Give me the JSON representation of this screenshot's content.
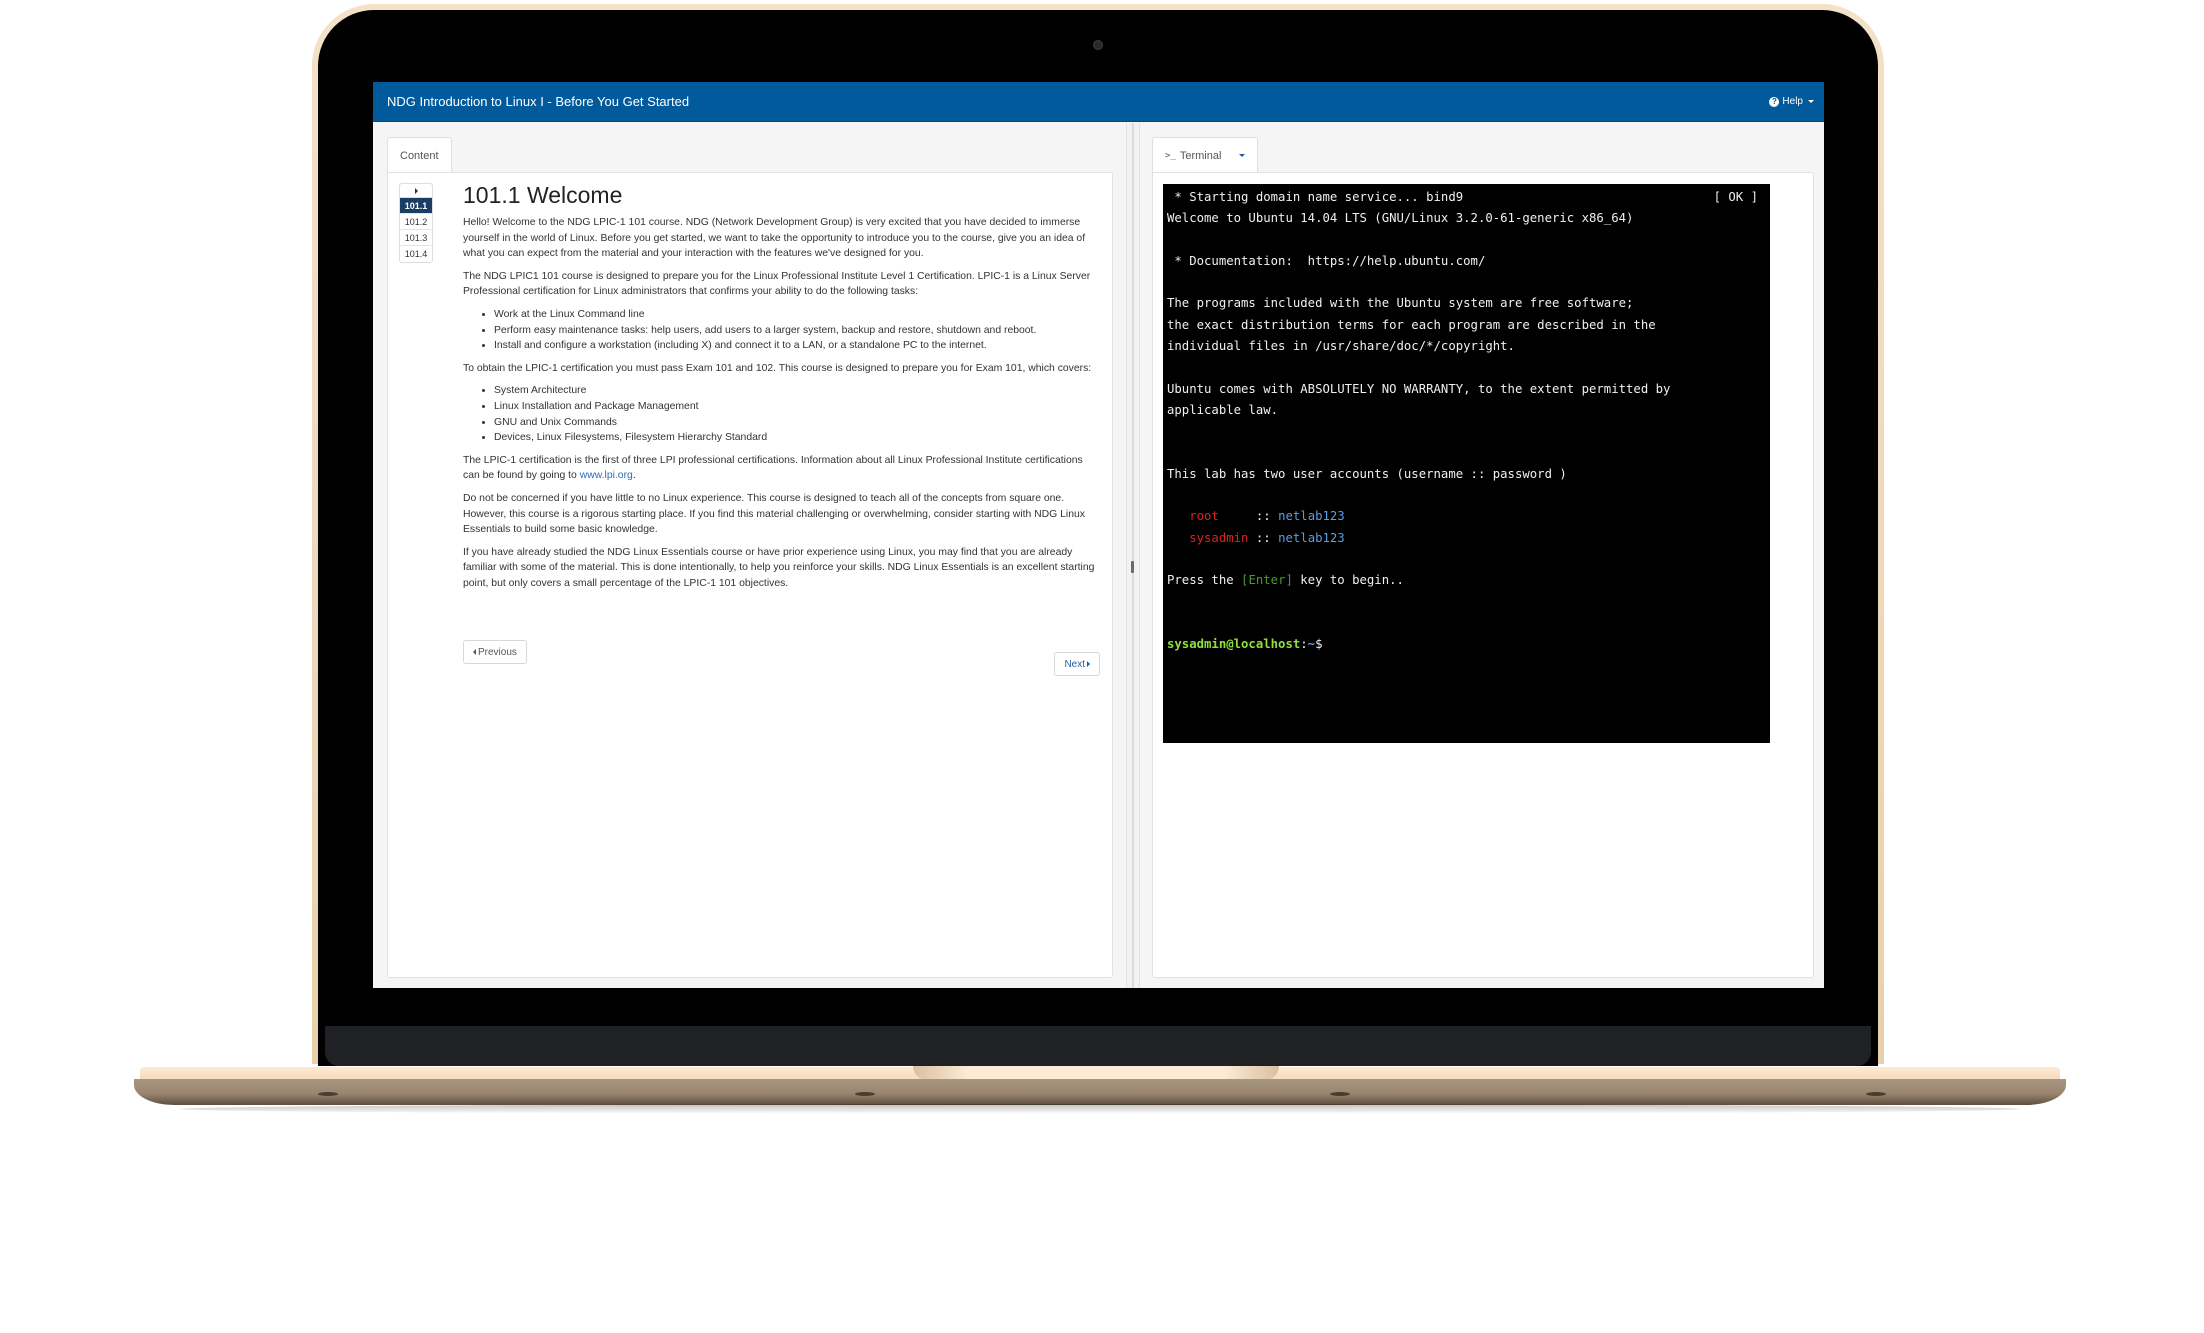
{
  "app": {
    "title": "NDG Introduction to Linux I - Before You Get Started",
    "help_label": "Help",
    "help_icon": "question-circle-icon"
  },
  "left_pane": {
    "tab_label": "Content",
    "lesson_nav": {
      "collapse_icon": "caret-right-icon",
      "items": [
        {
          "label": "101.1",
          "active": true
        },
        {
          "label": "101.2",
          "active": false
        },
        {
          "label": "101.3",
          "active": false
        },
        {
          "label": "101.4",
          "active": false
        }
      ]
    },
    "article": {
      "heading": "101.1 Welcome",
      "p1": "Hello! Welcome to the NDG LPIC-1 101 course. NDG (Network Development Group) is very excited that you have decided to immerse yourself in the world of Linux. Before you get started, we want to take the opportunity to introduce you to the course, give you an idea of what you can expect from the material and your interaction with the features we've designed for you.",
      "p2": "The NDG LPIC1 101 course is designed to prepare you for the Linux Professional Institute Level 1 Certification. LPIC-1 is a Linux Server Professional certification for Linux administrators that confirms your ability to do the following tasks:",
      "tasks": [
        "Work at the Linux Command line",
        "Perform easy maintenance tasks: help users, add users to a larger system, backup and restore, shutdown and reboot.",
        "Install and configure a workstation (including X) and connect it to a LAN, or a standalone PC to the internet."
      ],
      "p3": "To obtain the LPIC-1 certification you must pass Exam 101 and 102. This course is designed to prepare you for Exam 101, which covers:",
      "topics": [
        "System Architecture",
        "Linux Installation and Package Management",
        "GNU and Unix Commands",
        "Devices, Linux Filesystems, Filesystem Hierarchy Standard"
      ],
      "p4_before_link": "The LPIC-1 certification is the first of three LPI professional certifications. Information about all Linux Professional Institute certifications can be found by going to ",
      "p4_link": "www.lpi.org",
      "p4_after_link": ".",
      "p5": "Do not be concerned if you have little to no Linux experience. This course is designed to teach all of the concepts from square one. However, this course is a rigorous starting place. If you find this material challenging or overwhelming, consider starting with NDG Linux Essentials to build some basic knowledge.",
      "p6": "If you have already studied the NDG Linux Essentials course or have prior experience using Linux, you may find that you are already familiar with some of the material. This is done intentionally, to help you reinforce your skills. NDG Linux Essentials is an excellent starting point, but only covers a small percentage of the LPIC-1 101 objectives."
    },
    "buttons": {
      "previous": "Previous",
      "next": "Next"
    }
  },
  "right_pane": {
    "tab_prompt": ">_",
    "tab_label": "Terminal",
    "terminal": {
      "line1": " * Starting domain name service... bind9",
      "line1_status": "[ OK ]",
      "line2": "Welcome to Ubuntu 14.04 LTS (GNU/Linux 3.2.0-61-generic x86_64)",
      "line4": " * Documentation:  https://help.ubuntu.com/",
      "line6": "The programs included with the Ubuntu system are free software;",
      "line7": "the exact distribution terms for each program are described in the",
      "line8": "individual files in /usr/share/doc/*/copyright.",
      "line10": "Ubuntu comes with ABSOLUTELY NO WARRANTY, to the extent permitted by",
      "line11": "applicable law.",
      "line14": "This lab has two user accounts (username :: password )",
      "accounts": [
        {
          "username": "root    ",
          "separator": " :: ",
          "password": "netlab123"
        },
        {
          "username": "sysadmin",
          "separator": " :: ",
          "password": "netlab123"
        }
      ],
      "press_before": "Press the ",
      "press_key": "[Enter]",
      "press_after": " key to begin..",
      "prompt_user": "sysadmin@localhost",
      "prompt_sep": ":",
      "prompt_path": "~",
      "prompt_symbol": "$"
    }
  },
  "colors": {
    "navbar": "#005a9c",
    "active_lesson": "#1a3d64",
    "terminal_bg": "#000000",
    "terminal_user": "#dd2020",
    "terminal_password": "#5d9de0",
    "terminal_prompt": "#8ee03a"
  }
}
